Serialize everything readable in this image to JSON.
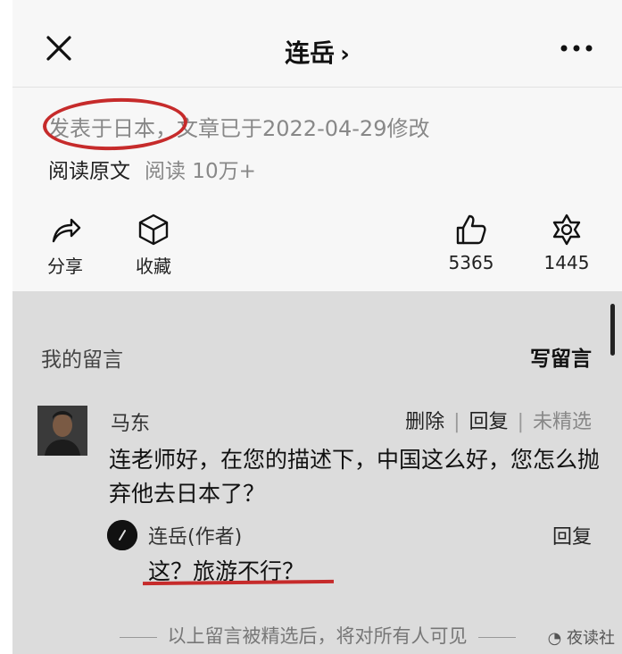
{
  "header": {
    "title": "连岳",
    "title_chevron": "›"
  },
  "article_meta": {
    "location_text": "发表于日本，文章已于2022-04-29修改",
    "read_original": "阅读原文",
    "read_count": "阅读 10万+"
  },
  "actions": {
    "share_label": "分享",
    "collect_label": "收藏",
    "like_count": "5365",
    "wow_count": "1445"
  },
  "comments": {
    "section_title": "我的留言",
    "write_label": "写留言",
    "comment": {
      "author": "马东",
      "delete_label": "删除",
      "reply_label": "回复",
      "not_selected_label": "未精选",
      "text": "连老师好，在您的描述下，中国这么好，您怎么抛弃他去日本了？"
    },
    "reply": {
      "author": "连岳(作者)",
      "reply_label": "回复",
      "text": "这？旅游不行？"
    },
    "footer_note": "以上留言被精选后，将对所有人可见",
    "watermark": "夜读社"
  },
  "colors": {
    "annotation_red": "#c62b2b",
    "comment_bg": "#dcdcdc"
  }
}
